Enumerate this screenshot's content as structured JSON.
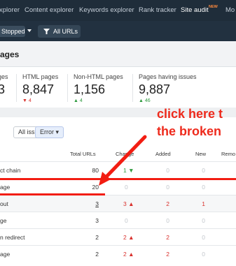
{
  "topnav": {
    "items": [
      "xplorer",
      "Content explorer",
      "Keywords explorer",
      "Rank tracker",
      "Site audit",
      "Mo"
    ],
    "active": "Site audit",
    "new_badge": "NEW"
  },
  "subbar": {
    "status": "Stopped",
    "filter_label": "All URLs"
  },
  "page": {
    "title": "ages"
  },
  "stats": [
    {
      "label": "ges",
      "value": "3",
      "change": ""
    },
    {
      "label": "HTML pages",
      "value": "8,847",
      "change": "▼ 4",
      "direction": "down"
    },
    {
      "label": "Non-HTML pages",
      "value": "1,156",
      "change": "▲ 4",
      "direction": "up"
    },
    {
      "label": "Pages having issues",
      "value": "9,887",
      "change": "▲ 46",
      "direction": "up"
    }
  ],
  "filters": {
    "all_issues": "All issues",
    "error": "Error ▾"
  },
  "table": {
    "headers": [
      "Total URLs",
      "Change",
      "Added",
      "New",
      "Remo"
    ],
    "rows": [
      {
        "name": "ct chain",
        "total": "80",
        "change": "1 ▼",
        "added": "0",
        "new": "0"
      },
      {
        "name": "age",
        "total": "20",
        "change": "0",
        "added": "0",
        "new": "0"
      },
      {
        "name": "out",
        "total": "3",
        "change": "3 ▲",
        "added": "2",
        "new": "1"
      },
      {
        "name": "ge",
        "total": "3",
        "change": "0",
        "added": "0",
        "new": "0"
      },
      {
        "name": "n redirect",
        "total": "2",
        "change": "2 ▲",
        "added": "2",
        "new": "0"
      },
      {
        "name": "age",
        "total": "2",
        "change": "2 ▲",
        "added": "2",
        "new": "0"
      }
    ]
  },
  "annotation": {
    "line1": "click here t",
    "line2": "the broken",
    "color": "#ee2a1c"
  },
  "colors": {
    "nav_bg": "#1f2d3a",
    "accent_red": "#d9302c",
    "accent_green": "#2e9a3e"
  }
}
